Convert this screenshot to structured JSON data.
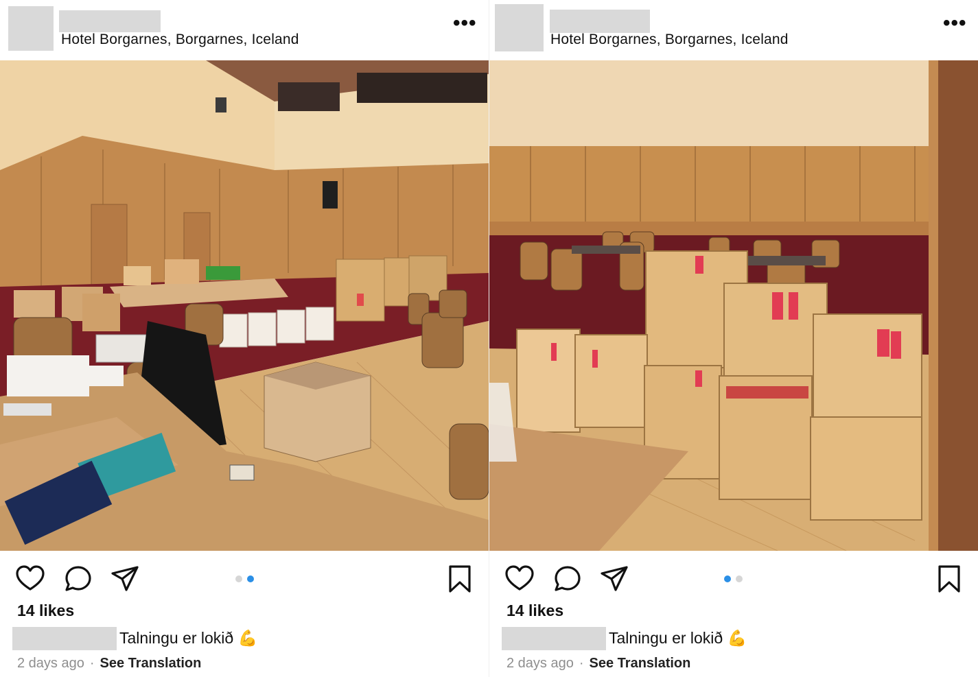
{
  "posts": [
    {
      "location": "Hotel Borgarnes, Borgarnes, Iceland",
      "more_icon": "•••",
      "likes": "14 likes",
      "caption": "Talningu er lokið 💪",
      "time": "2 days ago",
      "translation": "See Translation",
      "carousel_active_index": 1,
      "carousel_count": 2
    },
    {
      "location": "Hotel Borgarnes, Borgarnes, Iceland",
      "more_icon": "•••",
      "likes": "14 likes",
      "caption": "Talningu er lokið 💪",
      "time": "2 days ago",
      "translation": "See Translation",
      "carousel_active_index": 0,
      "carousel_count": 2
    }
  ],
  "colors": {
    "accent_dot": "#2b8fe6",
    "redacted": "#d9d9d9",
    "wood": "#d6a66a",
    "box": "#e6c28a",
    "wall": "#f0d3a0"
  }
}
